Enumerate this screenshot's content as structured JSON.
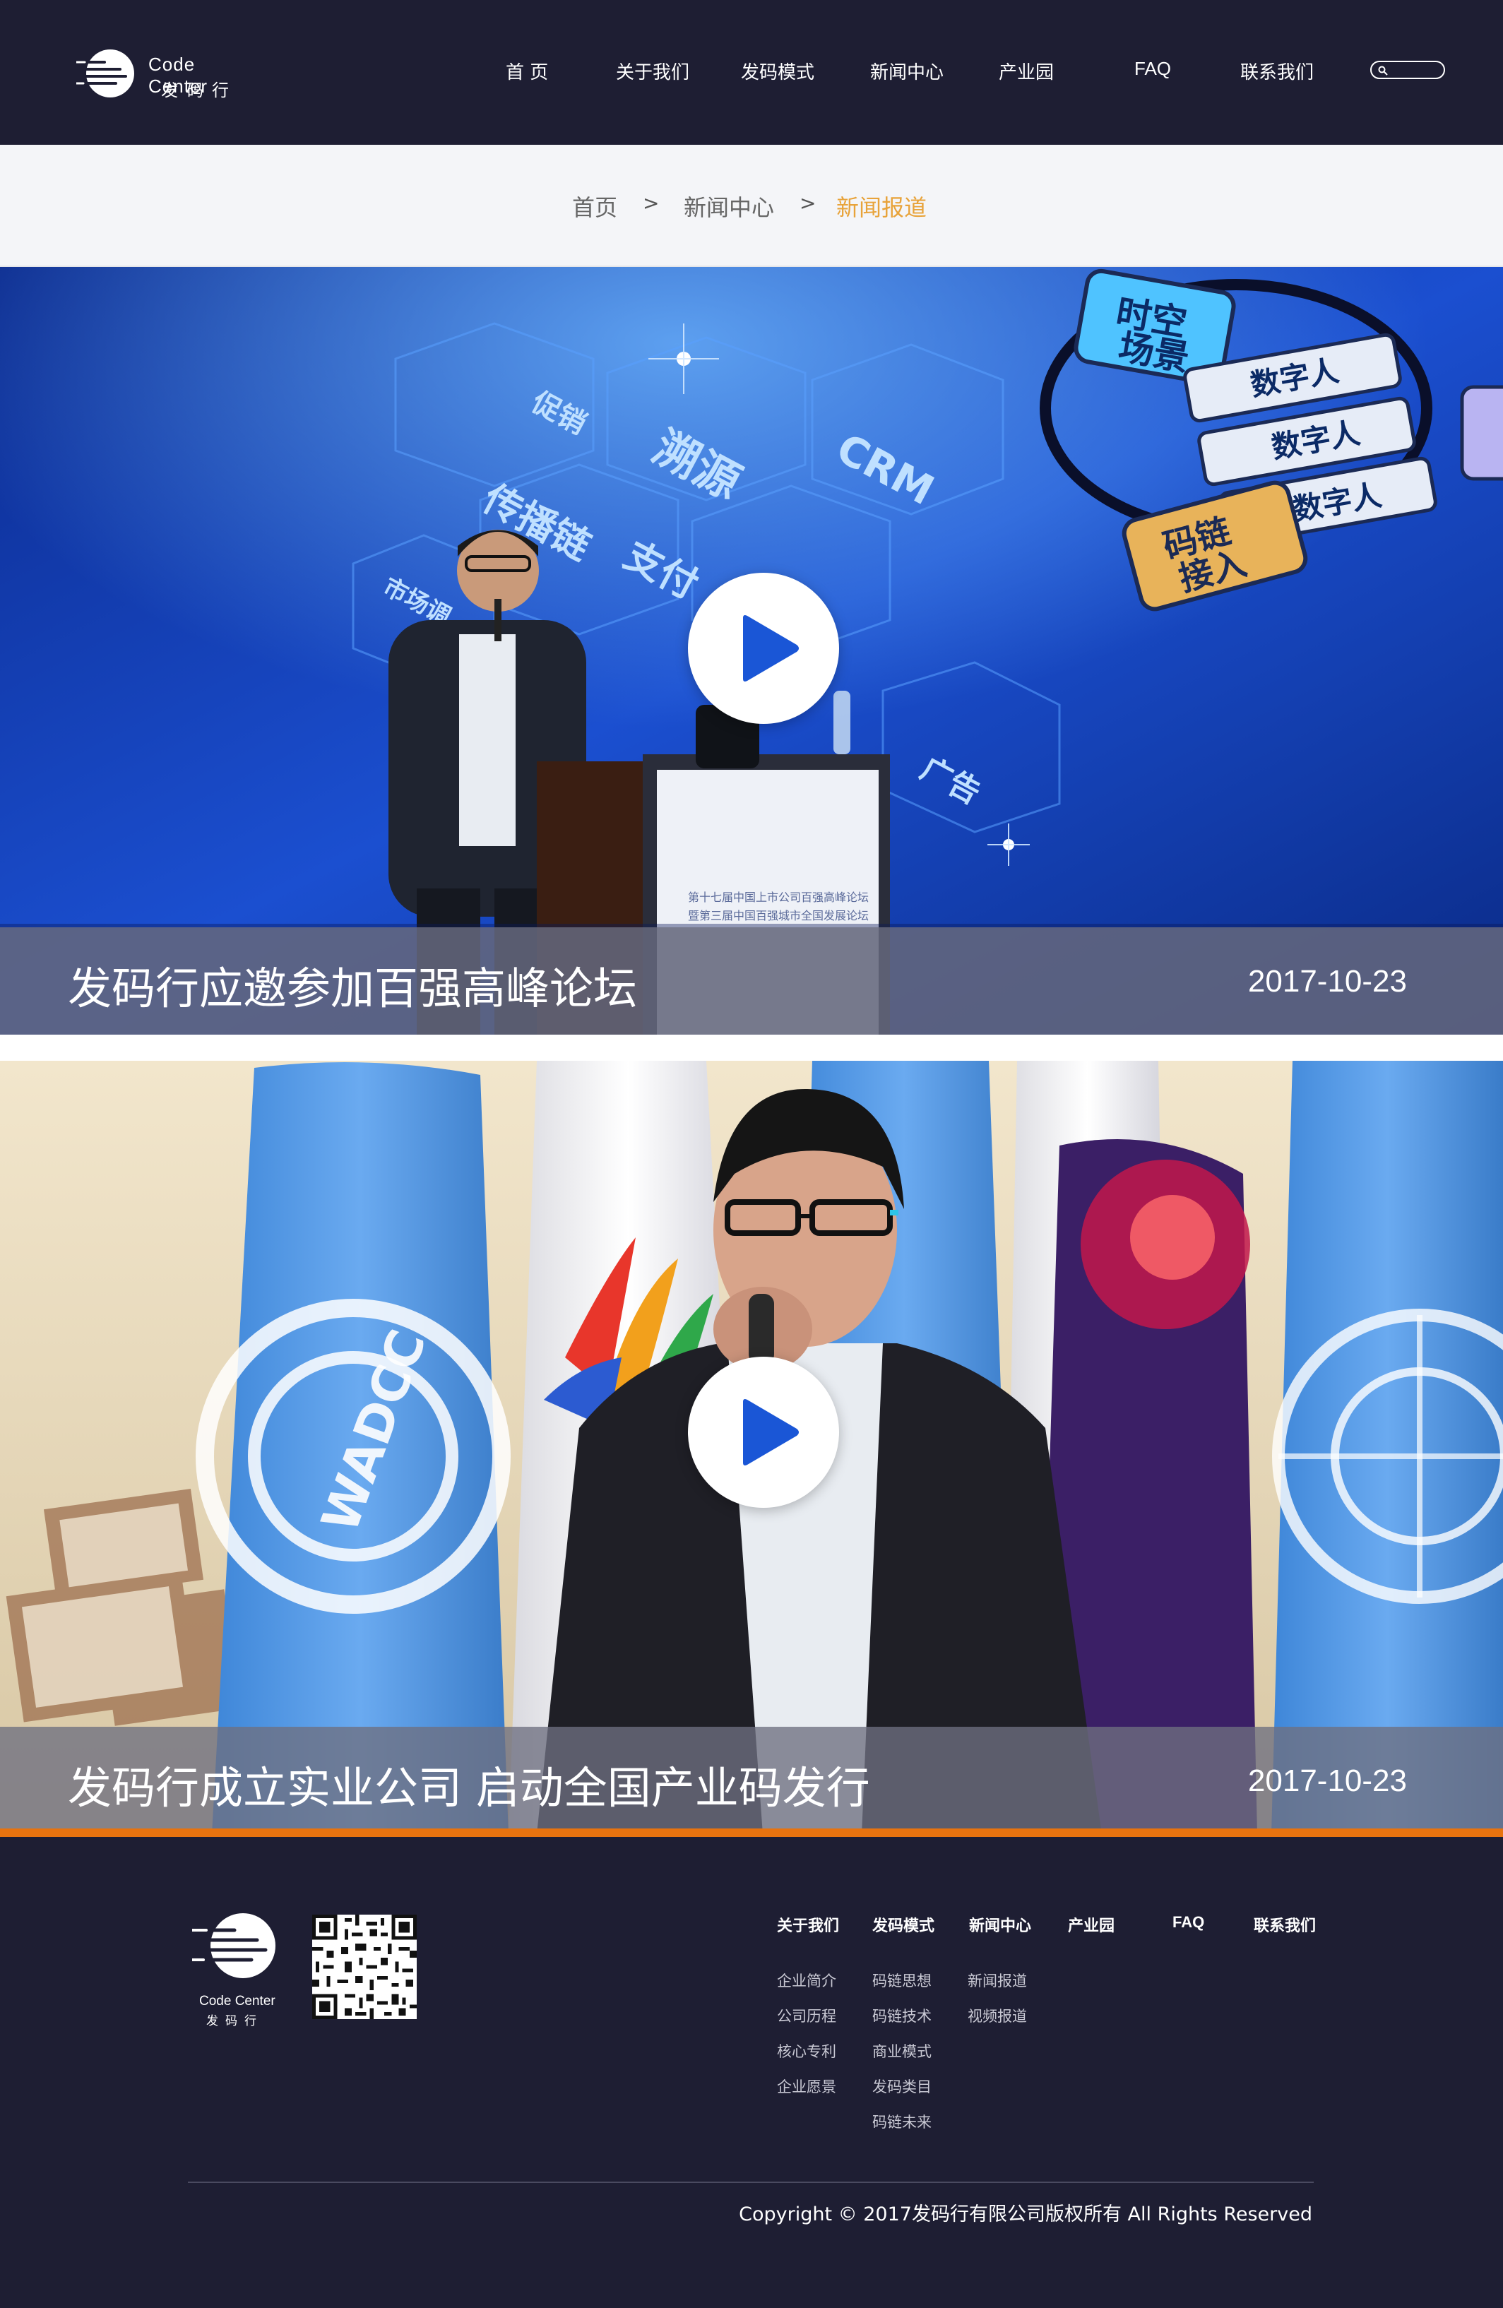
{
  "header": {
    "logo_en": "Code Center",
    "logo_cn": "发码行",
    "nav": [
      "首 页",
      "关于我们",
      "发码模式",
      "新闻中心",
      "产业园",
      "FAQ",
      "联系我们"
    ],
    "search_icon": "search-icon"
  },
  "breadcrumb": {
    "home": "首页",
    "section": "新闻中心",
    "current": "新闻报道",
    "separator": ">"
  },
  "news": [
    {
      "title": "发码行应邀参加百强高峰论坛",
      "date": "2017-10-23",
      "stage_words": [
        "时空场景",
        "数字人",
        "溯源",
        "CRM",
        "促销",
        "传播链",
        "支付",
        "码链接入",
        "广告",
        "市场调"
      ],
      "banner_text": [
        "第十七届中国上市公司百强高峰论坛",
        "暨第三届中国百强城市全国发展论坛"
      ]
    },
    {
      "title": "发码行成立实业公司 启动全国产业码发行",
      "date": "2017-10-23",
      "flag_text": "WADCC"
    }
  ],
  "footer": {
    "logo_en": "Code Center",
    "logo_cn": "发码行",
    "columns": [
      {
        "head": "关于我们",
        "links": [
          "企业简介",
          "公司历程",
          "核心专利",
          "企业愿景"
        ]
      },
      {
        "head": "发码模式",
        "links": [
          "码链思想",
          "码链技术",
          "商业模式",
          "发码类目",
          "码链未来"
        ]
      },
      {
        "head": "新闻中心",
        "links": [
          "新闻报道",
          "视频报道"
        ]
      },
      {
        "head": "产业园",
        "links": []
      },
      {
        "head": "FAQ",
        "links": []
      },
      {
        "head": "联系我们",
        "links": []
      }
    ],
    "copyright": "Copyright  ©  2017发码行有限公司版权所有 All Rights Reserved"
  },
  "colors": {
    "header_bg": "#1e1e33",
    "breadcrumb_active": "#e8a33a",
    "accent_line": "#e8730f",
    "play_icon": "#1a56d6"
  }
}
